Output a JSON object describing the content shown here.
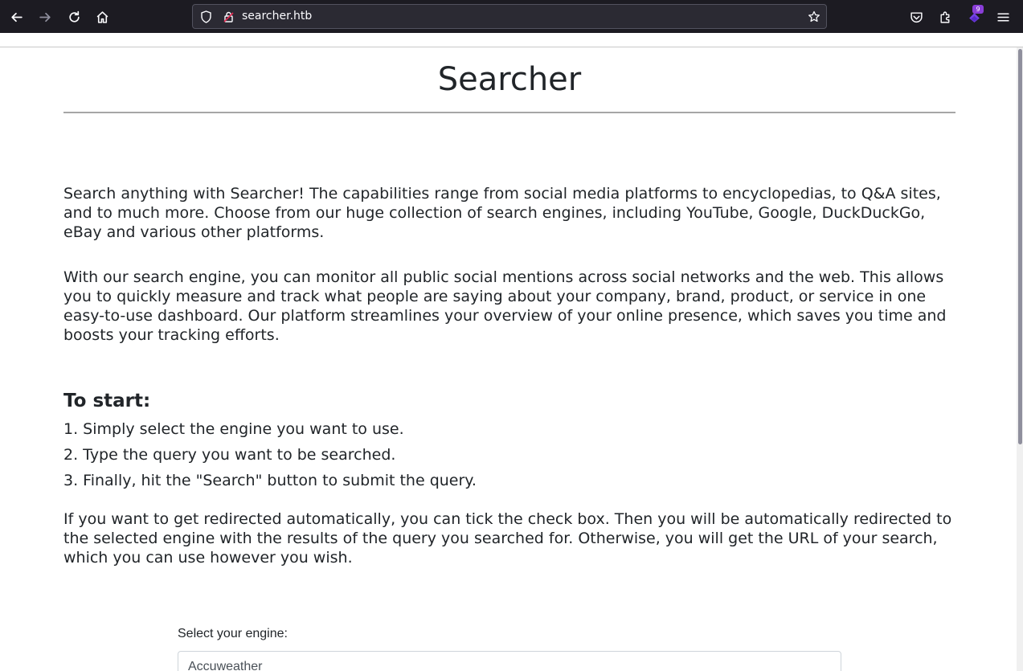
{
  "browser": {
    "url": "searcher.htb",
    "extension_badge": "9"
  },
  "page": {
    "title": "Searcher",
    "intro_paragraph": "Search anything with Searcher! The capabilities range from social media platforms to encyclopedias, to Q&A sites, and to much more. Choose from our huge collection of search engines, including YouTube, Google, DuckDuckGo, eBay and various other platforms.",
    "monitor_paragraph": "With our search engine, you can monitor all public social mentions across social networks and the web. This allows you to quickly measure and track what people are saying about your company, brand, product, or service in one easy-to-use dashboard. Our platform streamlines your overview of your online presence, which saves you time and boosts your tracking efforts.",
    "steps_heading": "To start:",
    "steps": [
      "1. Simply select the engine you want to use.",
      "2. Type the query you want to be searched.",
      "3. Finally, hit the \"Search\" button to submit the query."
    ],
    "redirect_paragraph": "If you want to get redirected automatically, you can tick the check box. Then you will be automatically redirected to the selected engine with the results of the query you searched for. Otherwise, you will get the URL of your search, which you can use however you wish.",
    "engine_label": "Select your engine:",
    "engine_selected": "Accuweather"
  }
}
